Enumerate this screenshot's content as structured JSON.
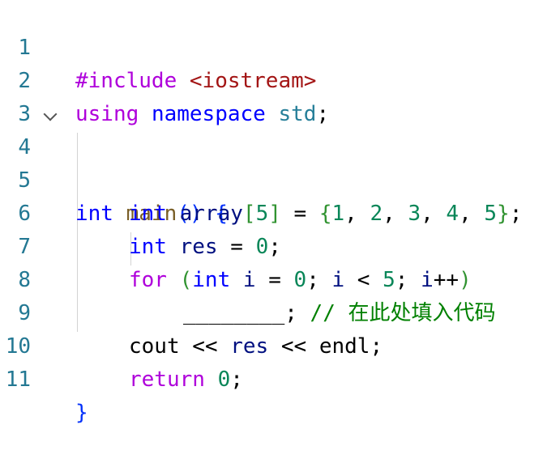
{
  "line_numbers": [
    "1",
    "2",
    "3",
    "4",
    "5",
    "6",
    "7",
    "8",
    "9",
    "10",
    "11"
  ],
  "lines": {
    "l1": {
      "directive": "#include",
      "header": "<iostream>"
    },
    "l2": {
      "using": "using",
      "namespace": "namespace",
      "std": "std",
      "semi": ";"
    },
    "l4": {
      "type": "int",
      "name": "main",
      "parens": "()",
      "brace": "{"
    },
    "l5": {
      "type": "int",
      "name": "array",
      "lb": "[",
      "size": "5",
      "rb": "]",
      "eq": " = ",
      "lbrace": "{",
      "v1": "1",
      "v2": "2",
      "v3": "3",
      "v4": "4",
      "v5": "5",
      "comma": ", ",
      "rbrace": "}",
      "semi": ";"
    },
    "l6": {
      "type": "int",
      "name": "res",
      "eq": " = ",
      "val": "0",
      "semi": ";"
    },
    "l7": {
      "for": "for",
      "lp": "(",
      "type": "int",
      "i": "i",
      "eq": " = ",
      "zero": "0",
      "semi1": "; ",
      "i2": "i",
      "lt": " < ",
      "five": "5",
      "semi2": "; ",
      "i3": "i",
      "inc": "++",
      "rp": ")"
    },
    "l8": {
      "blank": "________",
      "semi": ";",
      "comment": "// 在此处填入代码"
    },
    "l9": {
      "cout": "cout",
      "op1": " << ",
      "res": "res",
      "op2": " << ",
      "endl": "endl",
      "semi": ";"
    },
    "l10": {
      "ret": "return",
      "val": "0",
      "semi": ";"
    },
    "l11": {
      "brace": "}"
    }
  },
  "colors": {
    "line_number": "#237893",
    "keyword": "#0000ff",
    "control": "#af00db",
    "function": "#795e26",
    "identifier": "#001080",
    "number": "#098658",
    "string": "#a31515",
    "namespace": "#267f99",
    "comment": "#008000"
  },
  "icons": {
    "fold": "chevron-down-icon"
  }
}
